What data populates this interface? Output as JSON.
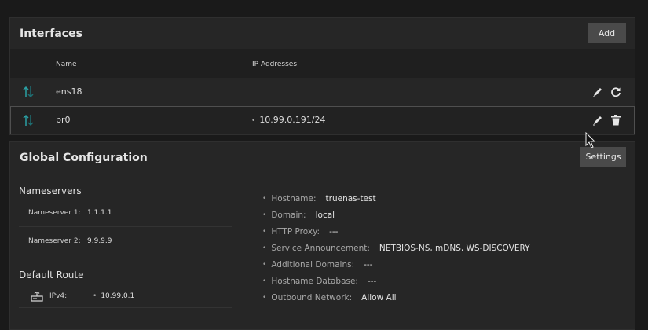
{
  "interfaces": {
    "title": "Interfaces",
    "add_label": "Add",
    "columns": {
      "name": "Name",
      "ip": "IP Addresses"
    },
    "rows": [
      {
        "name": "ens18",
        "ip": ""
      },
      {
        "name": "br0",
        "ip": "10.99.0.191/24"
      }
    ]
  },
  "global": {
    "title": "Global Configuration",
    "settings_label": "Settings",
    "nameservers": {
      "title": "Nameservers",
      "items": [
        {
          "label": "Nameserver 1:",
          "value": "1.1.1.1"
        },
        {
          "label": "Nameserver 2:",
          "value": "9.9.9.9"
        }
      ]
    },
    "default_route": {
      "title": "Default Route",
      "label": "IPv4:",
      "value": "10.99.0.1"
    },
    "info": [
      {
        "label": "Hostname:",
        "value": "truenas-test"
      },
      {
        "label": "Domain:",
        "value": "local"
      },
      {
        "label": "HTTP Proxy:",
        "value": "---"
      },
      {
        "label": "Service Announcement:",
        "value": "NETBIOS-NS, mDNS, WS-DISCOVERY"
      },
      {
        "label": "Additional Domains:",
        "value": "---"
      },
      {
        "label": "Hostname Database:",
        "value": "---"
      },
      {
        "label": "Outbound Network:",
        "value": "Allow All"
      }
    ]
  },
  "colors": {
    "icon_accent": "#2aa0a4",
    "background": "#1a1a1a",
    "card": "#262626"
  },
  "icons": [
    "up-down-arrows-icon",
    "pencil-icon",
    "refresh-icon",
    "trash-icon",
    "router-icon",
    "mouse-cursor-icon"
  ]
}
